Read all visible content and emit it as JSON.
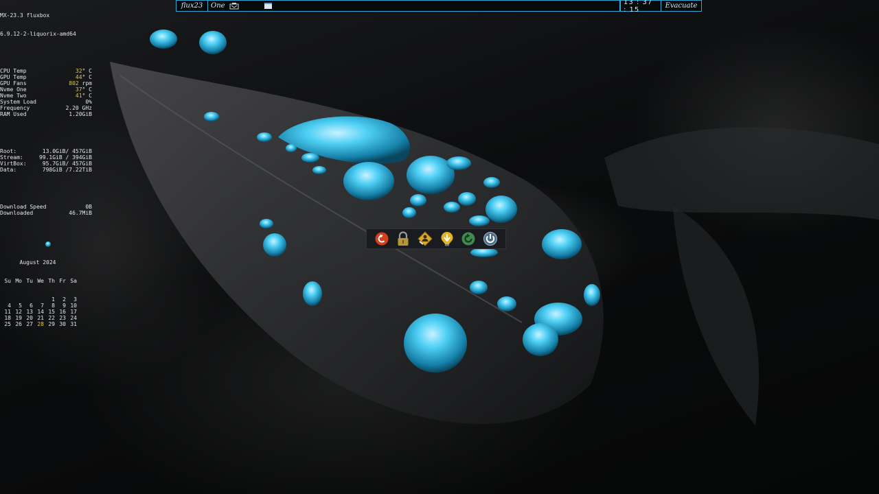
{
  "system": {
    "distro": "MX-23.3 fluxbox",
    "kernel": "6.9.12-2-liquorix-amd64"
  },
  "sensors": [
    {
      "label": "CPU Temp",
      "value": "32",
      "unit": "° C"
    },
    {
      "label": "GPU Temp",
      "value": "44",
      "unit": "° C"
    },
    {
      "label": "GPU Fans",
      "value": "802",
      "unit": " rpm"
    },
    {
      "label": "Nvme One",
      "value": "37",
      "unit": "° C"
    },
    {
      "label": "Nvme Two",
      "value": "41",
      "unit": "° C"
    },
    {
      "label": "System Load",
      "value": "0%",
      "unit": ""
    },
    {
      "label": "Frequency",
      "value": "2.20 GHz",
      "unit": ""
    },
    {
      "label": "RAM Used",
      "value": "1.20GiB",
      "unit": ""
    }
  ],
  "disks": [
    {
      "label": "Root:",
      "value": "13.0GiB/ 457GiB"
    },
    {
      "label": "Stream:",
      "value": "99.1GiB / 394GiB"
    },
    {
      "label": "VirtBox:",
      "value": "95.7GiB/ 457GiB"
    },
    {
      "label": "Data:",
      "value": "798GiB /7.22TiB"
    }
  ],
  "network": [
    {
      "label": "Download Speed",
      "value": "0B"
    },
    {
      "label": "Downloaded",
      "value": "46.7MiB"
    }
  ],
  "calendar": {
    "title": "August 2024",
    "weekdays": [
      "Su",
      "Mo",
      "Tu",
      "We",
      "Th",
      "Fr",
      "Sa"
    ],
    "weeks": [
      [
        "",
        "",
        "",
        "",
        "1",
        "2",
        "3"
      ],
      [
        "4",
        "5",
        "6",
        "7",
        "8",
        "9",
        "10"
      ],
      [
        "11",
        "12",
        "13",
        "14",
        "15",
        "16",
        "17"
      ],
      [
        "18",
        "19",
        "20",
        "21",
        "22",
        "23",
        "24"
      ],
      [
        "25",
        "26",
        "27",
        "28",
        "29",
        "30",
        "31"
      ]
    ],
    "today": "28"
  },
  "toolbar": {
    "workspace_label": "flux23",
    "workspace_name": "One",
    "clock": "13 : 37 : 15",
    "evacuate_label": "Evacuate"
  },
  "dock": {
    "buttons": [
      {
        "name": "logout-button",
        "icon": "logout-arrow-icon",
        "color": "#d2401f"
      },
      {
        "name": "lock-button",
        "icon": "padlock-icon",
        "color": "#b7953a"
      },
      {
        "name": "switch-user-button",
        "icon": "switch-user-icon",
        "color": "#d8a92a"
      },
      {
        "name": "suspend-button",
        "icon": "suspend-icon",
        "color": "#e0b426"
      },
      {
        "name": "restart-button",
        "icon": "restart-icon",
        "color": "#3f8a4f"
      },
      {
        "name": "shutdown-button",
        "icon": "power-icon",
        "color": "#4a90c8"
      }
    ]
  },
  "colors": {
    "accent": "#36a6d6",
    "highlight": "#e6c84a",
    "drops": "#3ec3ee"
  }
}
